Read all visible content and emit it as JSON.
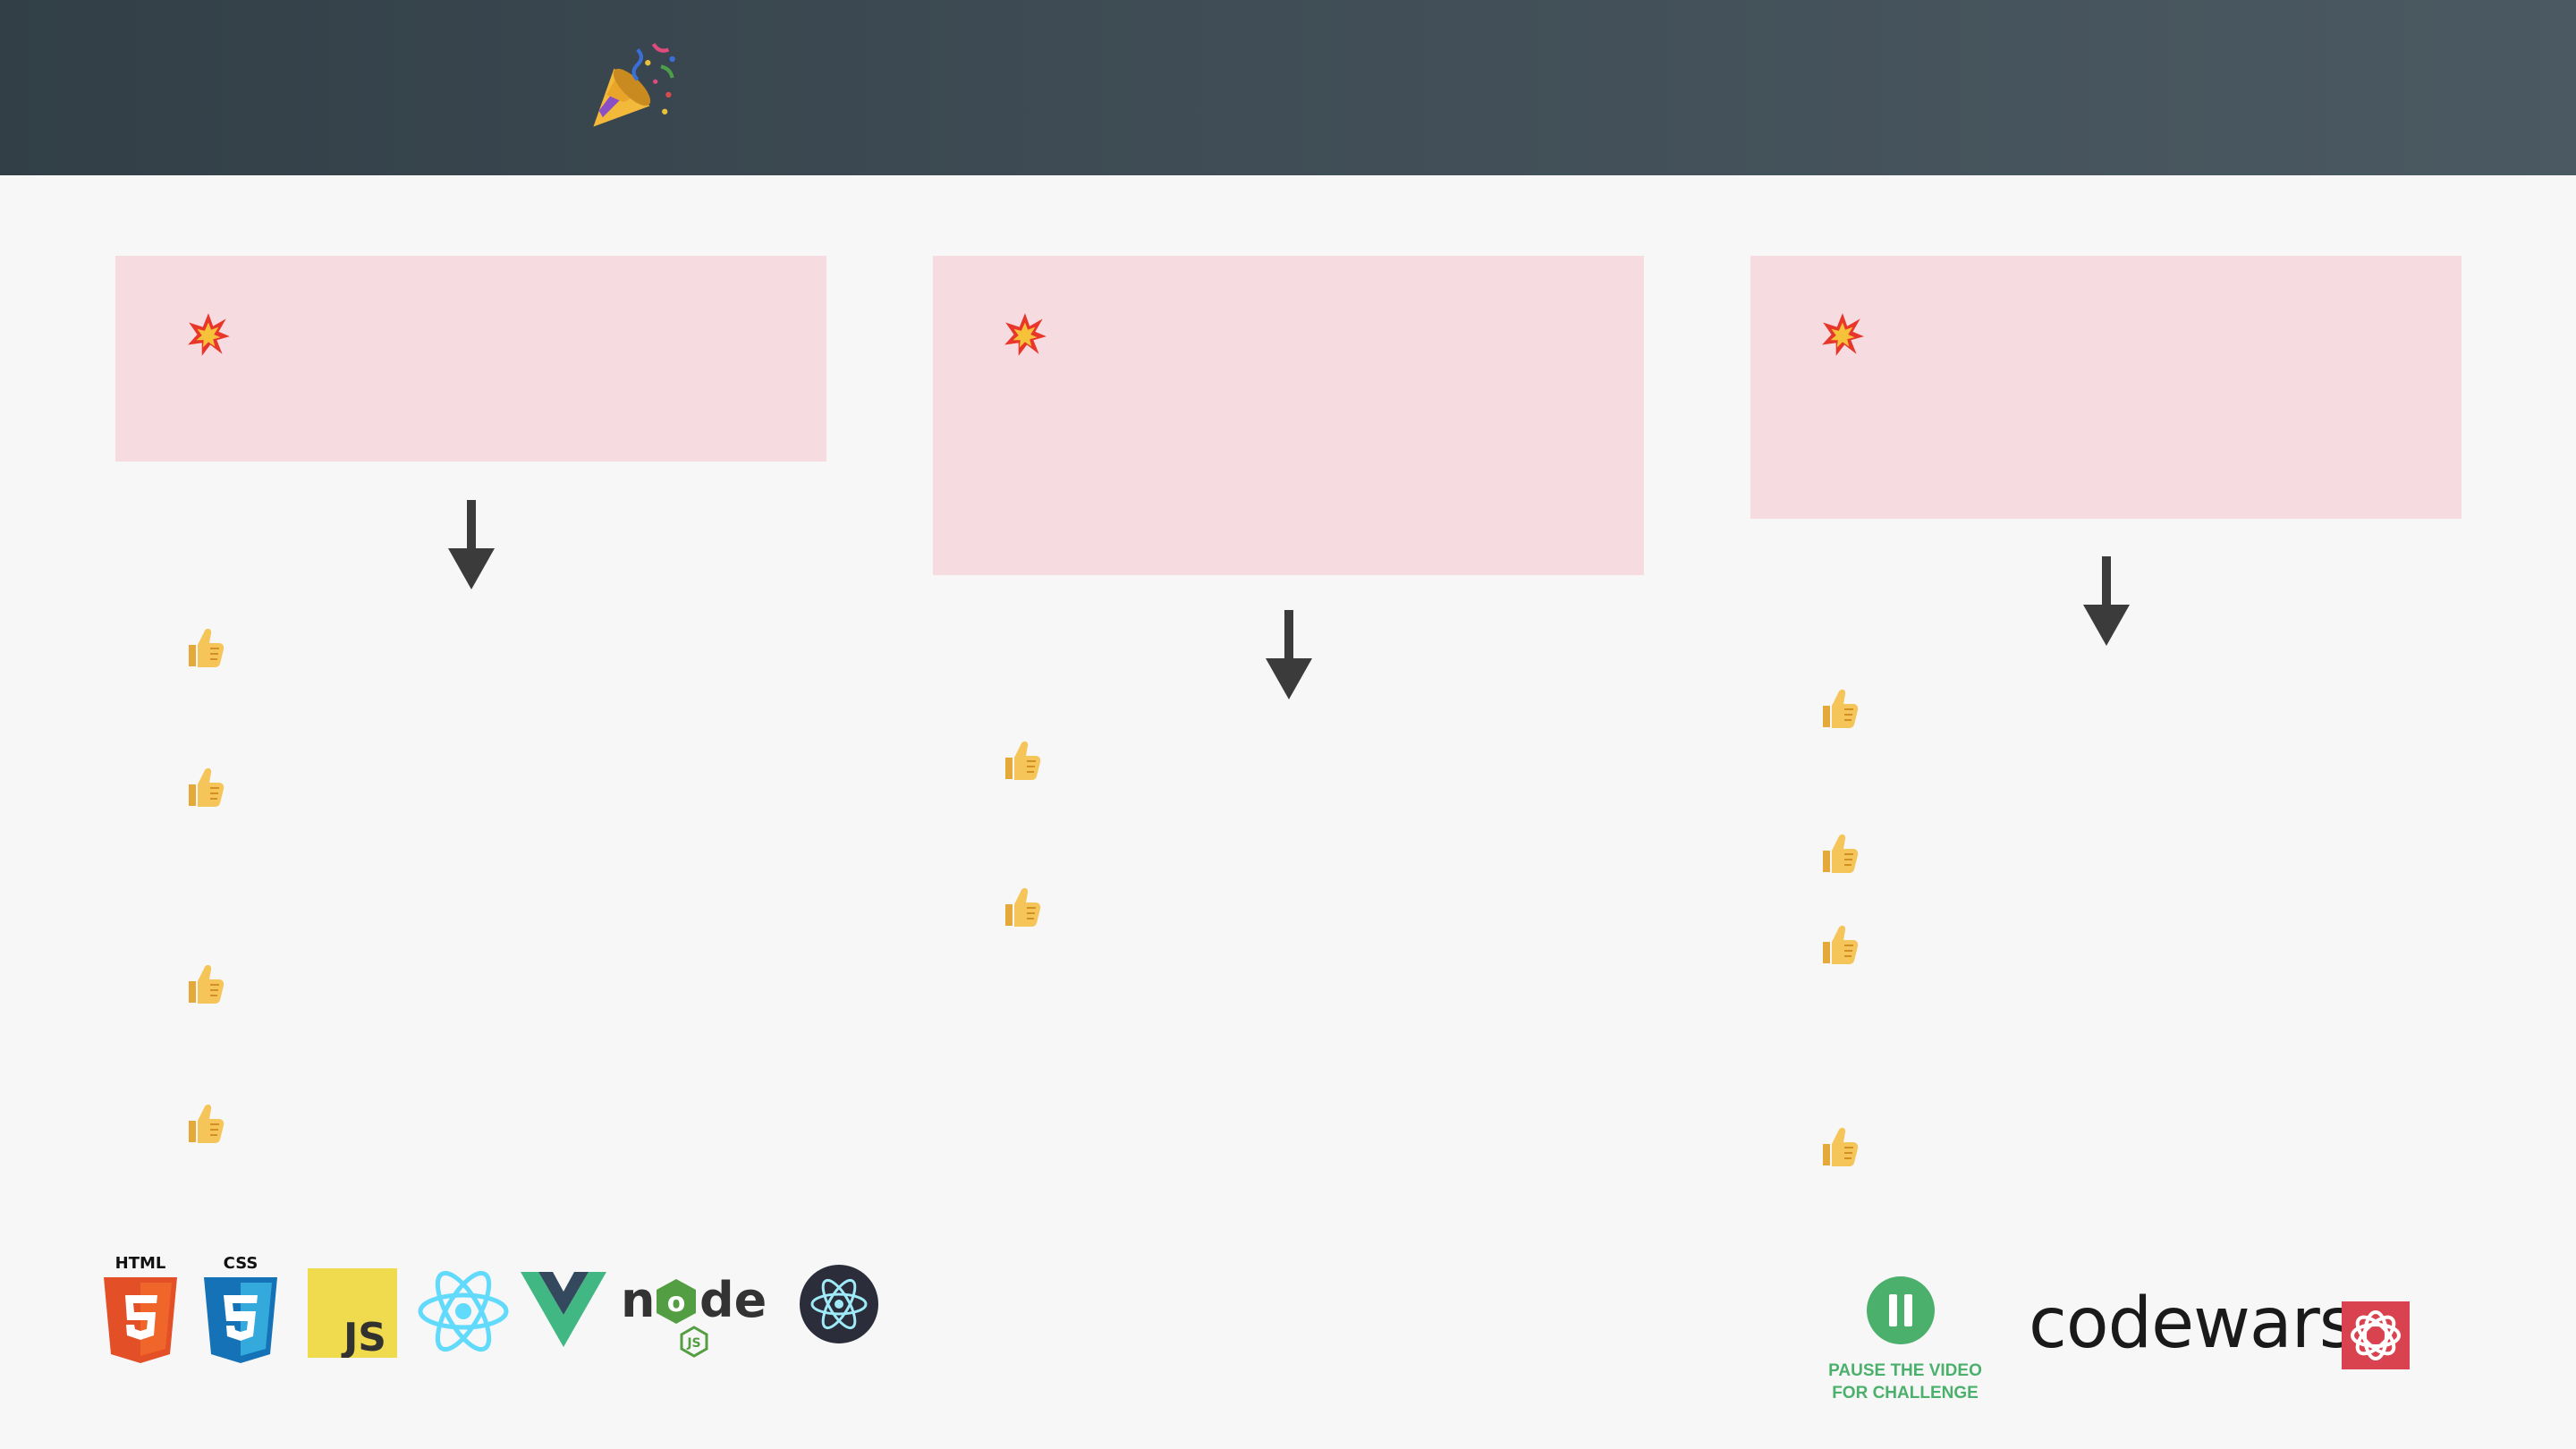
{
  "header": {
    "icon": "party-popper-icon"
  },
  "columns": [
    {
      "card_icon": "collision-icon",
      "arrow_icon": "arrow-down-icon",
      "bullet_icon": "thumbs-up-icon",
      "bullet_count": 4
    },
    {
      "card_icon": "collision-icon",
      "arrow_icon": "arrow-down-icon",
      "bullet_icon": "thumbs-up-icon",
      "bullet_count": 2
    },
    {
      "card_icon": "collision-icon",
      "arrow_icon": "arrow-down-icon",
      "bullet_icon": "thumbs-up-icon",
      "bullet_count": 4
    }
  ],
  "tech_logos": [
    {
      "name": "html5-logo",
      "label": "HTML"
    },
    {
      "name": "css3-logo",
      "label": "CSS"
    },
    {
      "name": "javascript-logo",
      "label": "JS"
    },
    {
      "name": "react-logo"
    },
    {
      "name": "vue-logo"
    },
    {
      "name": "nodejs-logo",
      "label": "node",
      "badge": "JS"
    },
    {
      "name": "electron-logo"
    }
  ],
  "pause": {
    "icon": "pause-icon",
    "line1": "PAUSE THE VIDEO",
    "line2": "FOR CHALLENGE",
    "color": "#4cb06d"
  },
  "codewars": {
    "wordmark": "codewars",
    "icon": "codewars-logo-icon",
    "icon_color": "#d9434f"
  },
  "colors": {
    "header_start": "#323f47",
    "header_end": "#4b5962",
    "card_bg": "#f6dce0",
    "page_bg": "#f7f7f7",
    "arrow": "#3b3b3b"
  }
}
